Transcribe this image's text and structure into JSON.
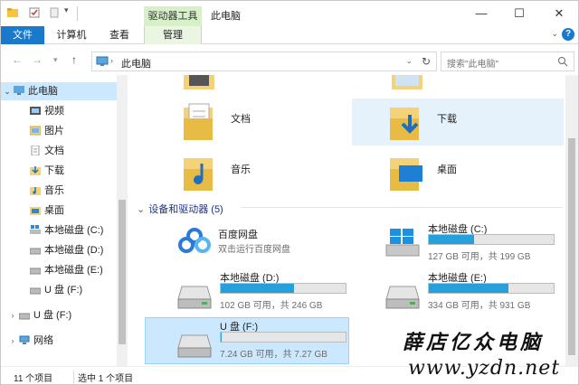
{
  "window": {
    "title": "此电脑",
    "context_tab": "驱动器工具",
    "controls": [
      "minimize-icon",
      "maximize-icon",
      "close-icon"
    ]
  },
  "ribbon": {
    "tabs": [
      "文件",
      "计算机",
      "查看",
      "管理"
    ],
    "help": "?"
  },
  "address": {
    "path": "此电脑",
    "search_placeholder": "搜索\"此电脑\""
  },
  "nav_pane": {
    "items": [
      "此电脑",
      "视频",
      "图片",
      "文档",
      "下载",
      "音乐",
      "桌面",
      "本地磁盘 (C:)",
      "本地磁盘 (D:)",
      "本地磁盘 (E:)",
      "U 盘 (F:)",
      "U 盘 (F:)",
      "网络"
    ]
  },
  "folders": [
    "文档",
    "下载",
    "音乐",
    "桌面"
  ],
  "group_header": "设备和驱动器 (5)",
  "drives": [
    {
      "name": "百度网盘",
      "subtitle": "双击运行百度网盘"
    },
    {
      "name": "本地磁盘 (C:)",
      "info": "127 GB 可用，共 199 GB",
      "used_fraction": 0.36
    },
    {
      "name": "本地磁盘 (D:)",
      "info": "102 GB 可用，共 246 GB",
      "used_fraction": 0.59
    },
    {
      "name": "本地磁盘 (E:)",
      "info": "334 GB 可用，共 931 GB",
      "used_fraction": 0.64
    },
    {
      "name": "U 盘 (F:)",
      "info": "7.24 GB 可用，共 7.27 GB",
      "used_fraction": 0.005
    }
  ],
  "status": {
    "count": "11 个项目",
    "selected": "选中 1 个项目"
  },
  "watermark": {
    "line1": "薛店亿众电脑",
    "line2": "www.yzdn.net"
  },
  "colors": {
    "accent": "#1979ca",
    "bar": "#26a0da",
    "context": "#d7f0c9"
  }
}
